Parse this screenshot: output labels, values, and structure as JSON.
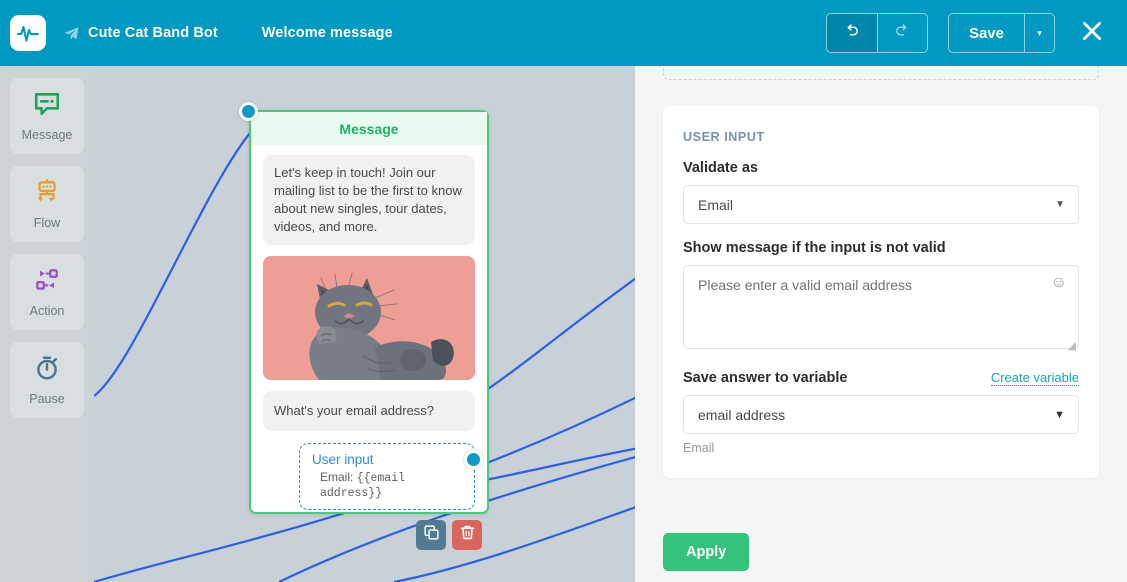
{
  "header": {
    "logo_icon": "pulse-logo-icon",
    "bot_name": "Cute Cat Band Bot",
    "bot_icon": "telegram-icon",
    "page_title": "Welcome message",
    "undo_icon": "undo-icon",
    "redo_icon": "redo-icon",
    "save_label": "Save",
    "save_caret": "▾",
    "close_icon": "close-icon",
    "accent_color": "#0099c1"
  },
  "sidebar": {
    "items": [
      {
        "label": "Message",
        "icon": "message-icon",
        "color": "#23a05c"
      },
      {
        "label": "Flow",
        "icon": "flow-robot-icon",
        "color": "#e8a02a"
      },
      {
        "label": "Action",
        "icon": "action-arrows-icon",
        "color": "#a04fc4"
      },
      {
        "label": "Pause",
        "icon": "stopwatch-icon",
        "color": "#49788e"
      }
    ]
  },
  "canvas": {
    "background_color": "#c7d1d7",
    "wire_color": "#2b5fe8",
    "node": {
      "title": "Message",
      "border_color": "#4cc97f",
      "text_bubble": "Let's keep in touch! Join our mailing list to be the first to know about new singles, tour dates, videos, and more.",
      "image_alt": "grey-cat-illustration",
      "image_bg": "#ef9e95",
      "question_bubble": "What's your email address?",
      "user_input": {
        "title": "User input",
        "value_prefix": "Email:",
        "value_variable": "{{email address}}"
      }
    },
    "actions": {
      "copy_icon": "copy-icon",
      "delete_icon": "trash-icon"
    }
  },
  "panel": {
    "section_title": "USER INPUT",
    "validate_label": "Validate as",
    "validate_value": "Email",
    "invalid_label": "Show message if the input is not valid",
    "invalid_placeholder": "Please enter a valid email address",
    "emoji_icon": "smiley-icon",
    "save_var_label": "Save answer to variable",
    "create_var_link": "Create variable",
    "variable_value": "email address",
    "variable_helper": "Email",
    "apply_label": "Apply"
  }
}
